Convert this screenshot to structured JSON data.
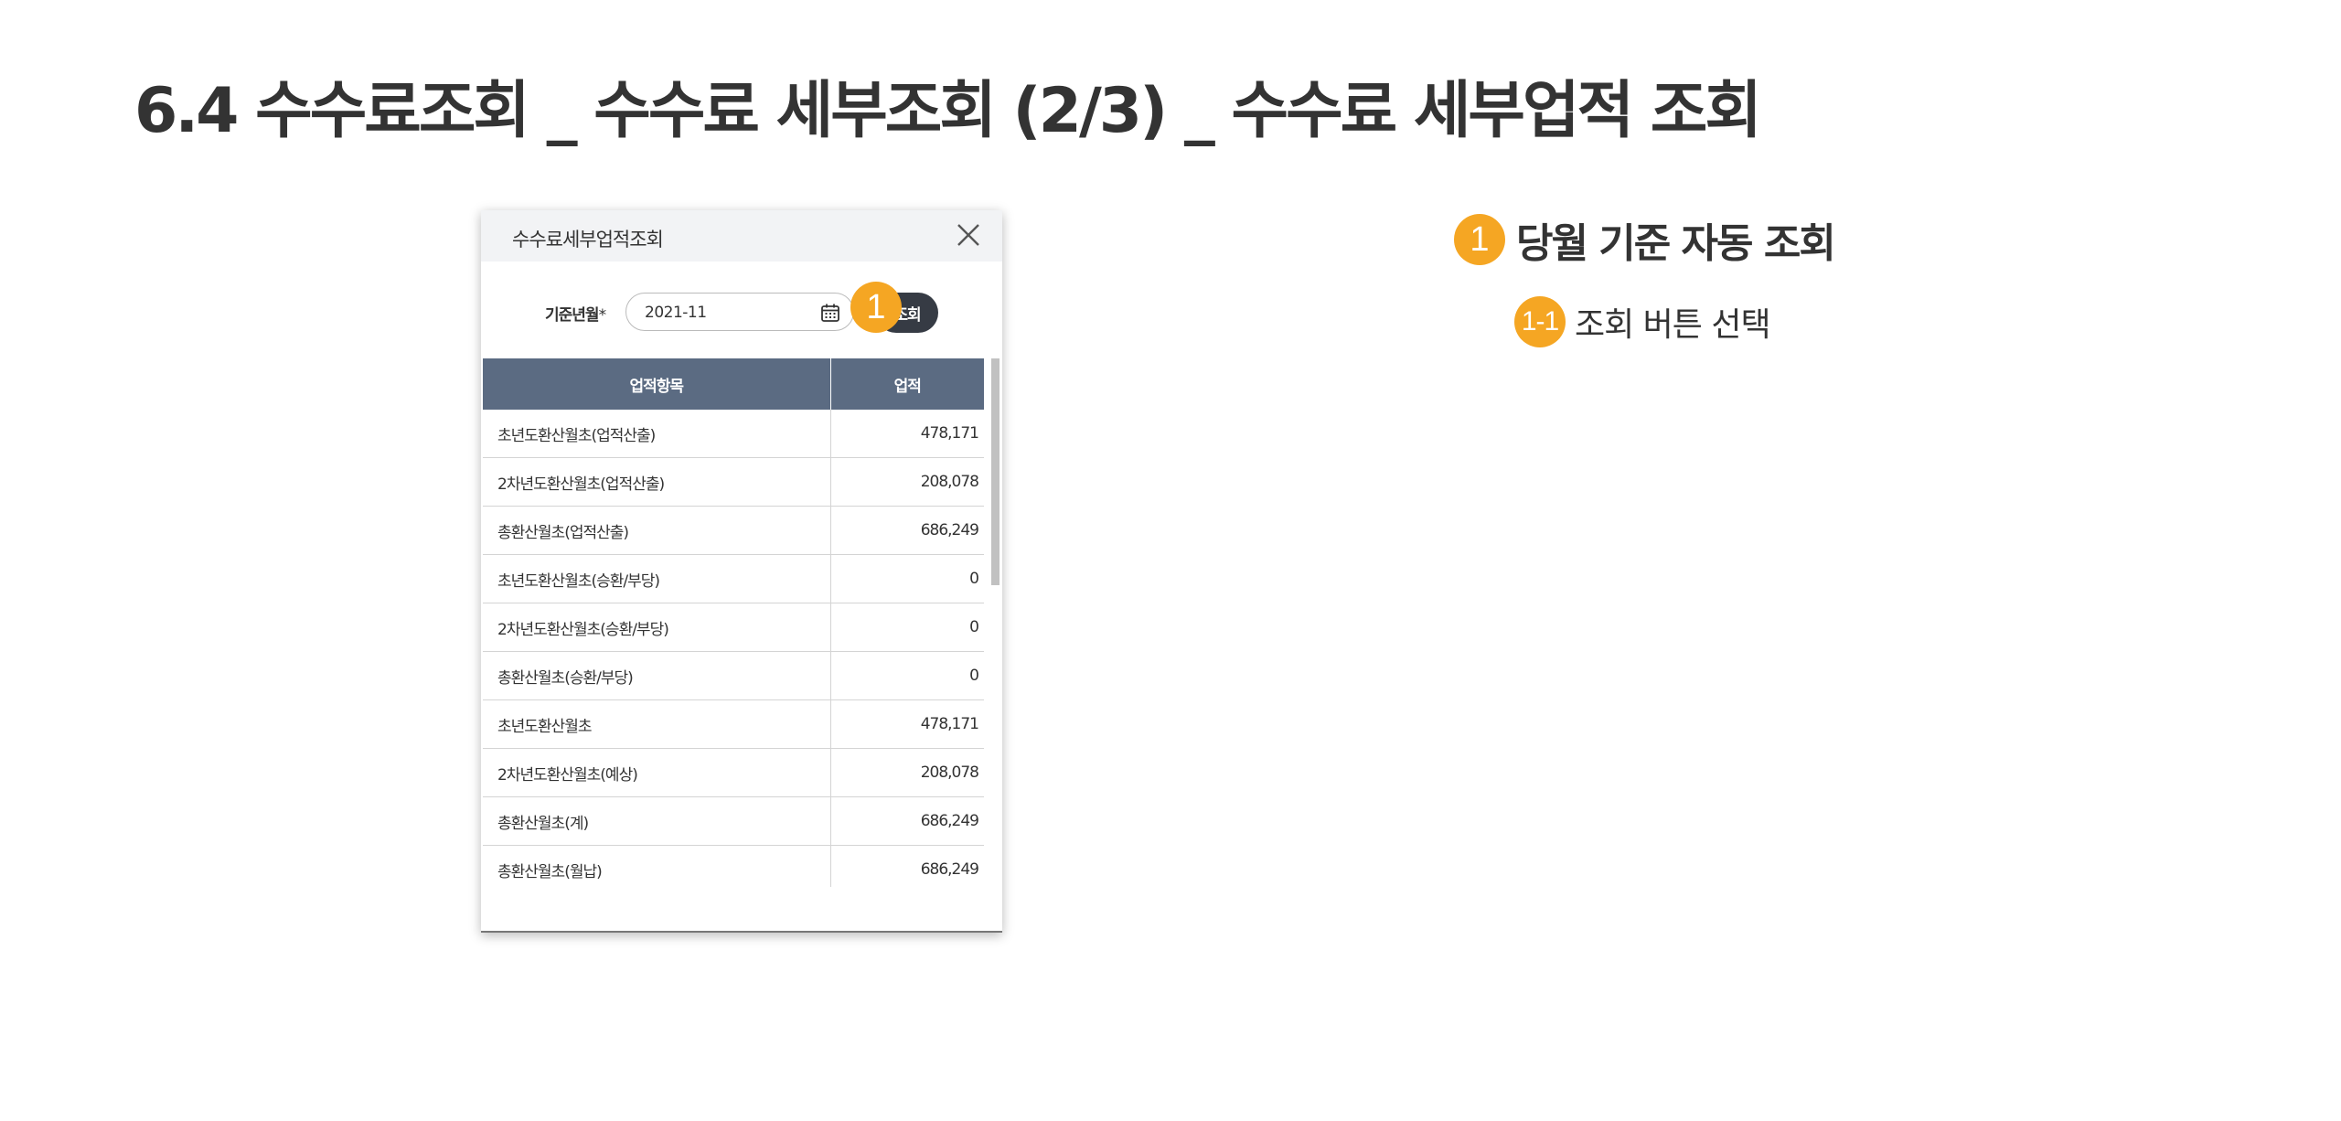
{
  "page": {
    "title": "6.4 수수료조회 _ 수수료 세부조회 (2/3) _ 수수료 세부업적 조회"
  },
  "popup": {
    "title": "수수료세부업적조회",
    "close_icon": "close-icon",
    "search": {
      "label": "기준년월",
      "required_mark": "*",
      "date_value": "2021-11",
      "calendar_icon": "calendar-icon",
      "button_label": "조회"
    },
    "badge": "1",
    "table": {
      "headers": [
        "업적항목",
        "업적"
      ],
      "rows": [
        {
          "item": "초년도환산월초(업적산출)",
          "value": "478,171"
        },
        {
          "item": "2차년도환산월초(업적산출)",
          "value": "208,078"
        },
        {
          "item": "총환산월초(업적산출)",
          "value": "686,249"
        },
        {
          "item": "초년도환산월초(승환/부당)",
          "value": "0"
        },
        {
          "item": "2차년도환산월초(승환/부당)",
          "value": "0"
        },
        {
          "item": "총환산월초(승환/부당)",
          "value": "0"
        },
        {
          "item": "초년도환산월초",
          "value": "478,171"
        },
        {
          "item": "2차년도환산월초(예상)",
          "value": "208,078"
        },
        {
          "item": "총환산월초(계)",
          "value": "686,249"
        },
        {
          "item": "총환산월초(월납)",
          "value": "686,249"
        }
      ]
    }
  },
  "notes": {
    "note1": {
      "badge": "1",
      "text": "당월 기준 자동 조회"
    },
    "note2": {
      "badge": "1-1",
      "text": "조회 버튼 선택"
    }
  },
  "colors": {
    "accent": "#f5a623",
    "table_header": "#5b6b82",
    "button": "#363b44"
  }
}
